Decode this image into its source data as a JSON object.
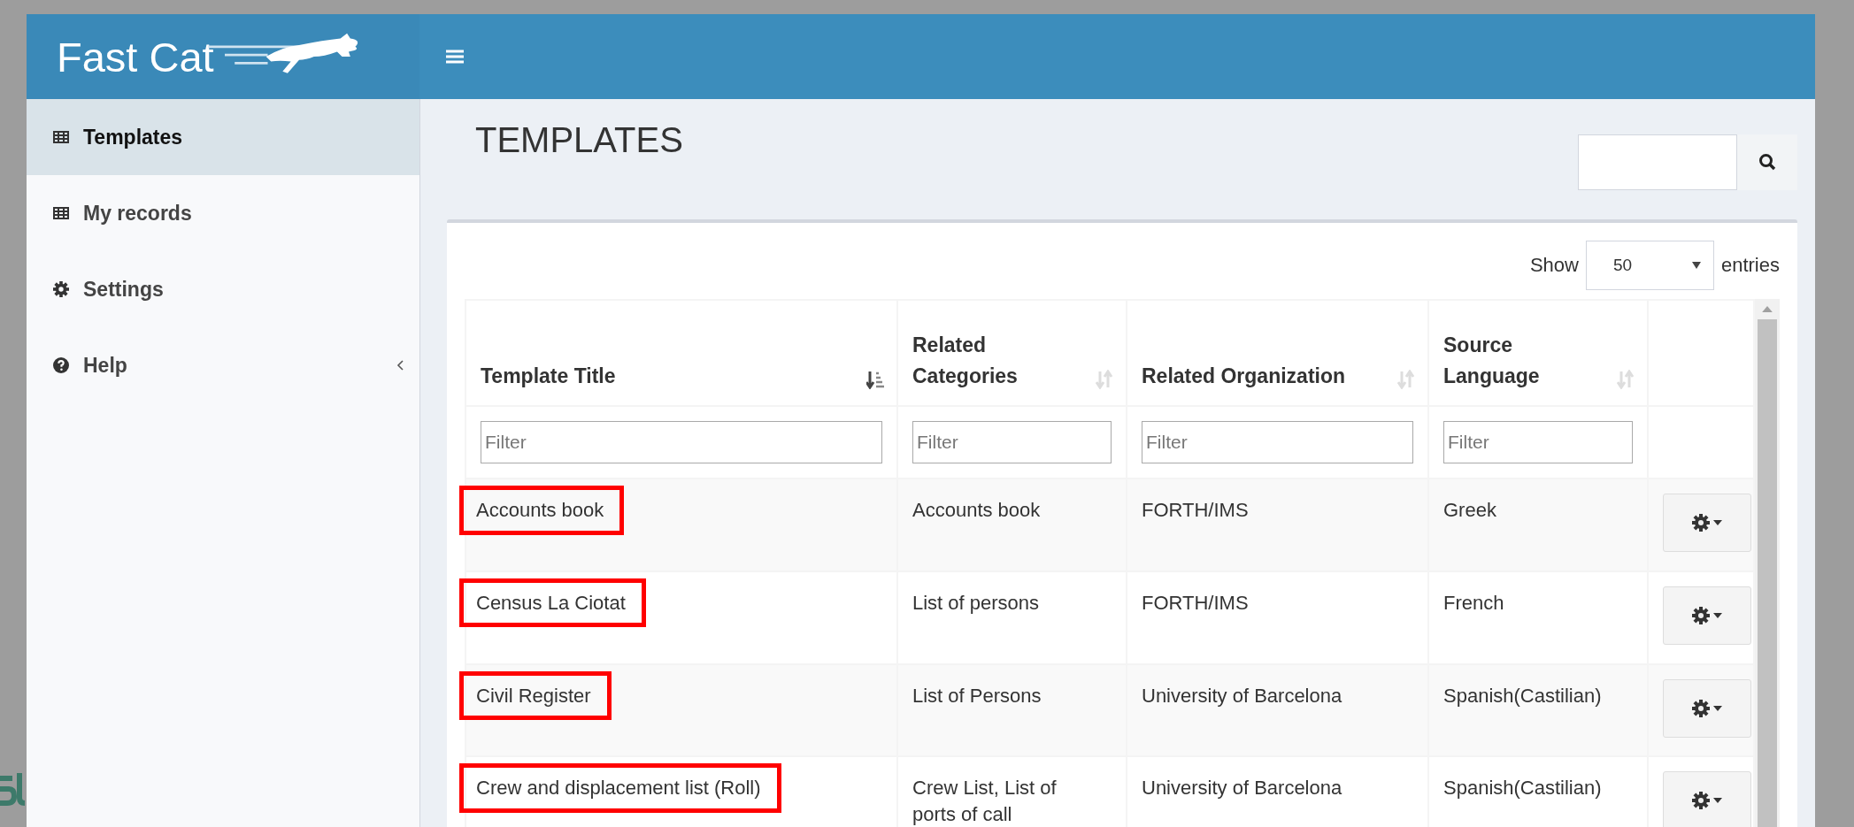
{
  "brand": {
    "name": "Fast Cat"
  },
  "sidebar": {
    "items": [
      {
        "label": "Templates",
        "kind": "table",
        "selected": true,
        "collapsible": false
      },
      {
        "label": "My records",
        "kind": "table",
        "selected": false,
        "collapsible": false
      },
      {
        "label": "Settings",
        "kind": "gear",
        "selected": false,
        "collapsible": false
      },
      {
        "label": "Help",
        "kind": "question",
        "selected": false,
        "collapsible": true
      }
    ]
  },
  "page": {
    "title": "TEMPLATES"
  },
  "table": {
    "show_label": "Show",
    "page_size": "50",
    "entries_label": "entries",
    "columns": [
      {
        "label": "Template Title",
        "sorted": true,
        "filter_placeholder": "Filter"
      },
      {
        "label": "Related Categories",
        "sorted": false,
        "filter_placeholder": "Filter"
      },
      {
        "label": "Related Organization",
        "sorted": false,
        "filter_placeholder": "Filter"
      },
      {
        "label": "Source Language",
        "sorted": false,
        "filter_placeholder": "Filter"
      }
    ],
    "rows": [
      {
        "title": "Accounts book",
        "category": "Accounts book",
        "organization": "FORTH/IMS",
        "language": "Greek",
        "marked": true
      },
      {
        "title": "Census La Ciotat",
        "category": "List of persons",
        "organization": "FORTH/IMS",
        "language": "French",
        "marked": true
      },
      {
        "title": "Civil Register",
        "category": "List of Persons",
        "organization": "University of Barcelona",
        "language": "Spanish(Castilian)",
        "marked": true
      },
      {
        "title": "Crew and displacement list (Roll)",
        "category": "Crew List, List of ports of call",
        "organization": "University of Barcelona",
        "language": "Spanish(Castilian)",
        "marked": true
      }
    ]
  }
}
